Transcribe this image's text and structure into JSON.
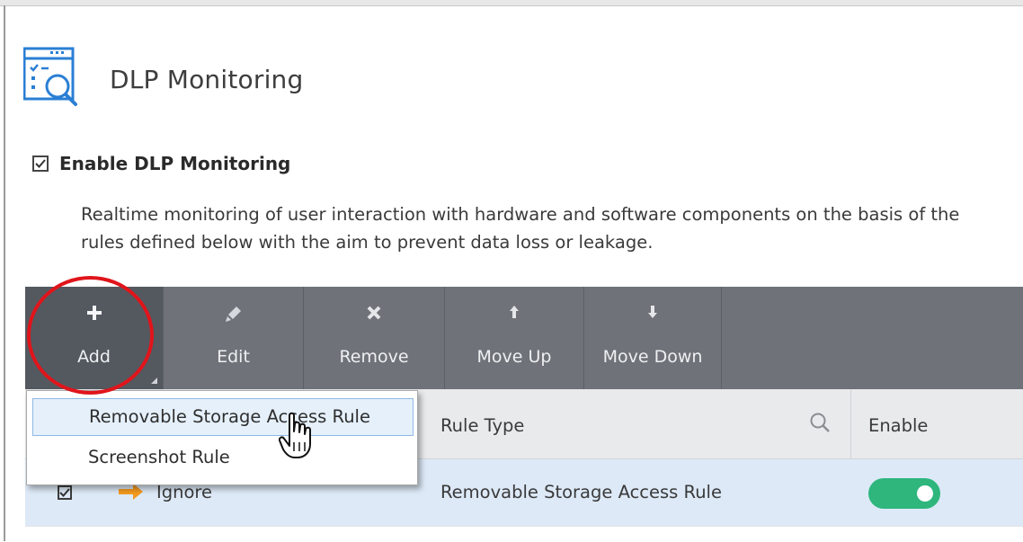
{
  "page": {
    "title": "DLP Monitoring",
    "header_icon": "monitoring-window-magnifier-icon"
  },
  "settings": {
    "enable_label": "Enable DLP Monitoring",
    "enable_checked": true,
    "description": "Realtime monitoring of user interaction with hardware and software components on the basis of the rules defined below with the aim to prevent data loss or leakage."
  },
  "toolbar": {
    "add_label": "Add",
    "edit_label": "Edit",
    "remove_label": "Remove",
    "move_up_label": "Move Up",
    "move_down_label": "Move Down"
  },
  "add_menu": {
    "items": [
      {
        "label": "Removable Storage Access Rule"
      },
      {
        "label": "Screenshot Rule"
      }
    ]
  },
  "table": {
    "columns": {
      "rule_type": "Rule Type",
      "enable": "Enable"
    },
    "rows": [
      {
        "checked": true,
        "action": "Ignore",
        "rule_type": "Removable Storage Access Rule",
        "enabled": true
      }
    ]
  },
  "colors": {
    "toolbar_bg": "#6f7379",
    "toggle_on": "#2eb67d",
    "highlight_circle": "#e0151b",
    "arrow": "#f39a1e",
    "selected_row": "#dde9f7"
  }
}
